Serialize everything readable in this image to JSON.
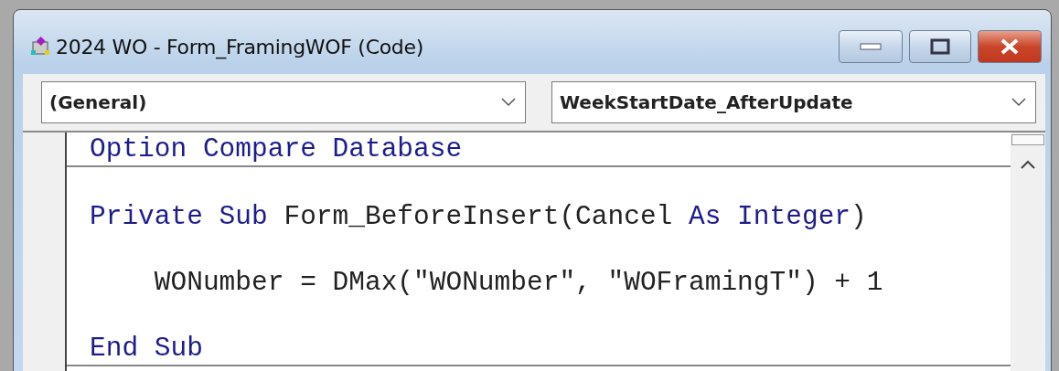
{
  "window": {
    "title": "2024 WO - Form_FramingWOF (Code)"
  },
  "object_dropdown": {
    "value": "(General)"
  },
  "procedure_dropdown": {
    "value": "WeekStartDate_AfterUpdate"
  },
  "code": {
    "blocks": [
      {
        "lines": [
          {
            "kind": "code",
            "tokens": [
              {
                "text": "Option Compare Database",
                "kind": "keyword"
              }
            ]
          }
        ]
      },
      {
        "lines": [
          {
            "kind": "blank"
          },
          {
            "kind": "code",
            "tokens": [
              {
                "text": "Private Sub",
                "kind": "keyword"
              },
              {
                "text": " Form_BeforeInsert(Cancel ",
                "kind": "plain"
              },
              {
                "text": "As Integer",
                "kind": "keyword"
              },
              {
                "text": ")",
                "kind": "plain"
              }
            ]
          },
          {
            "kind": "blank"
          },
          {
            "kind": "code",
            "tokens": [
              {
                "text": "    WONumber = DMax(\"WONumber\", \"WOFramingT\") + 1",
                "kind": "plain"
              }
            ]
          },
          {
            "kind": "blank"
          },
          {
            "kind": "code",
            "tokens": [
              {
                "text": "End Sub",
                "kind": "keyword"
              }
            ]
          }
        ]
      }
    ]
  }
}
